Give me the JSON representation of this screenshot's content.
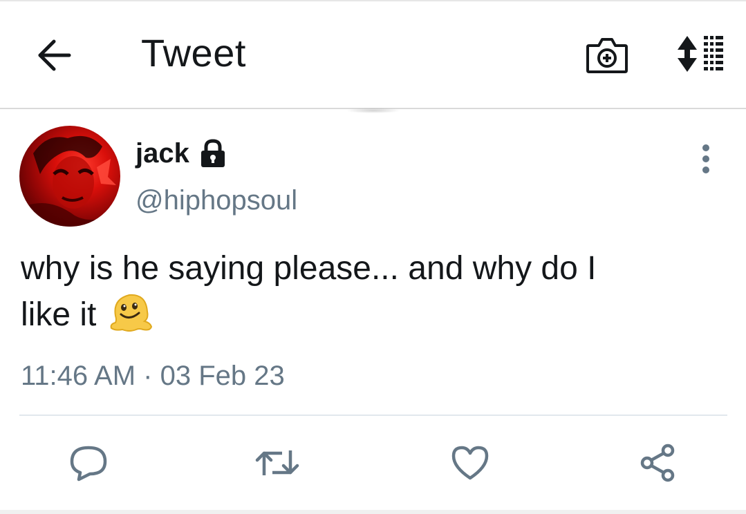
{
  "header": {
    "title": "Tweet",
    "back_icon": "arrow-left-icon",
    "camera_icon": "camera-plus-icon",
    "sort_icon": "sort-list-icon"
  },
  "tweet": {
    "author": {
      "display_name": "jack",
      "handle": "@hiphopsoul",
      "protected_icon": "lock-icon",
      "avatar_color": "#d90f0a"
    },
    "text_line1": "why is he saying please... and why do I",
    "text_line2": "like it",
    "emoji": "melting-face-icon",
    "time": "11:46 AM",
    "separator": "·",
    "date": "03 Feb 23"
  },
  "actions": [
    {
      "name": "reply",
      "icon": "reply-icon"
    },
    {
      "name": "retweet",
      "icon": "retweet-icon"
    },
    {
      "name": "like",
      "icon": "heart-icon"
    },
    {
      "name": "share",
      "icon": "share-icon"
    }
  ],
  "colors": {
    "primary_text": "#14171a",
    "secondary_text": "#657786",
    "icon": "#657786",
    "divider": "#e1e8ed"
  }
}
